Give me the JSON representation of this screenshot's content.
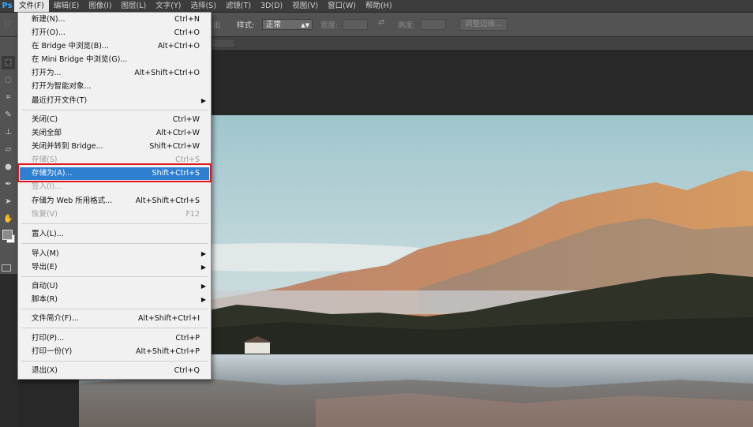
{
  "app": {
    "logo": "Ps"
  },
  "menubar": {
    "items": [
      "文件(F)",
      "编辑(E)",
      "图像(I)",
      "图层(L)",
      "文字(Y)",
      "选择(S)",
      "滤镜(T)",
      "3D(D)",
      "视图(V)",
      "窗口(W)",
      "帮助(H)"
    ],
    "active_index": 0
  },
  "options_bar": {
    "label_fragment": "出",
    "style_label": "样式:",
    "style_value": "正常",
    "width_label": "宽度:",
    "height_label": "高度:",
    "refine_button": "调整边缘..."
  },
  "file_menu": {
    "items": [
      {
        "label": "新建(N)...",
        "shortcut": "Ctrl+N"
      },
      {
        "label": "打开(O)...",
        "shortcut": "Ctrl+O"
      },
      {
        "label": "在 Bridge 中浏览(B)...",
        "shortcut": "Alt+Ctrl+O"
      },
      {
        "label": "在 Mini Bridge 中浏览(G)...",
        "shortcut": ""
      },
      {
        "label": "打开为...",
        "shortcut": "Alt+Shift+Ctrl+O"
      },
      {
        "label": "打开为智能对象...",
        "shortcut": ""
      },
      {
        "label": "最近打开文件(T)",
        "shortcut": "",
        "submenu": true
      },
      {
        "label": "关闭(C)",
        "shortcut": "Ctrl+W"
      },
      {
        "label": "关闭全部",
        "shortcut": "Alt+Ctrl+W"
      },
      {
        "label": "关闭并转到 Bridge...",
        "shortcut": "Shift+Ctrl+W"
      },
      {
        "label": "存储(S)",
        "shortcut": "Ctrl+S",
        "disabled": true
      },
      {
        "label": "存储为(A)...",
        "shortcut": "Shift+Ctrl+S",
        "highlighted": true
      },
      {
        "label": "签入(I)...",
        "shortcut": "",
        "disabled": true
      },
      {
        "label": "存储为 Web 所用格式...",
        "shortcut": "Alt+Shift+Ctrl+S"
      },
      {
        "label": "恢复(V)",
        "shortcut": "F12",
        "disabled": true
      },
      {
        "label": "置入(L)...",
        "shortcut": ""
      },
      {
        "label": "导入(M)",
        "shortcut": "",
        "submenu": true
      },
      {
        "label": "导出(E)",
        "shortcut": "",
        "submenu": true
      },
      {
        "label": "自动(U)",
        "shortcut": "",
        "submenu": true
      },
      {
        "label": "脚本(R)",
        "shortcut": "",
        "submenu": true
      },
      {
        "label": "文件简介(F)...",
        "shortcut": "Alt+Shift+Ctrl+I"
      },
      {
        "label": "打印(P)...",
        "shortcut": "Ctrl+P"
      },
      {
        "label": "打印一份(Y)",
        "shortcut": "Alt+Shift+Ctrl+P"
      },
      {
        "label": "退出(X)",
        "shortcut": "Ctrl+Q"
      }
    ]
  },
  "colors": {
    "highlight": "#2f7fd0",
    "callout_border": "#e0141b"
  }
}
